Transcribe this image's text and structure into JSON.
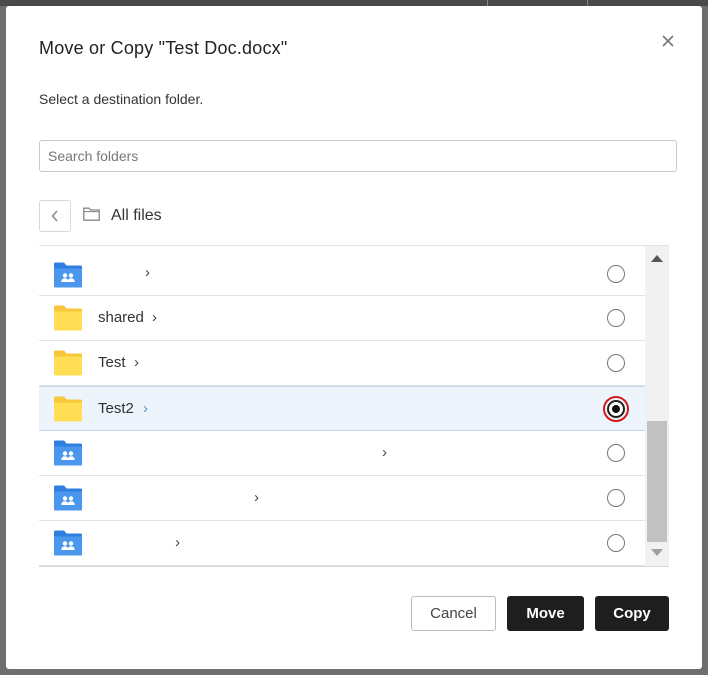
{
  "dialog": {
    "title": "Move or Copy \"Test Doc.docx\"",
    "subtitle": "Select a destination folder.",
    "close_icon": "close-icon"
  },
  "search": {
    "placeholder": "Search folders",
    "value": ""
  },
  "breadcrumb": {
    "back_icon": "chevron-left-icon",
    "folder_icon": "folder-outline-icon",
    "label": "All files"
  },
  "folders": [
    {
      "name": "",
      "type": "shared",
      "selected": false
    },
    {
      "name": "shared",
      "type": "regular",
      "selected": false
    },
    {
      "name": "Test",
      "type": "regular",
      "selected": false
    },
    {
      "name": "Test2",
      "type": "regular",
      "selected": true
    },
    {
      "name": "",
      "type": "shared",
      "selected": false
    },
    {
      "name": "",
      "type": "shared",
      "selected": false
    },
    {
      "name": "",
      "type": "shared",
      "selected": false
    }
  ],
  "chevron": "›",
  "buttons": {
    "cancel": "Cancel",
    "move": "Move",
    "copy": "Copy"
  },
  "colors": {
    "shared_folder": "#2f7fe0",
    "regular_folder": "#ffd740",
    "selected_row": "#eef4fb",
    "highlight_ring": "#d21a1a"
  }
}
